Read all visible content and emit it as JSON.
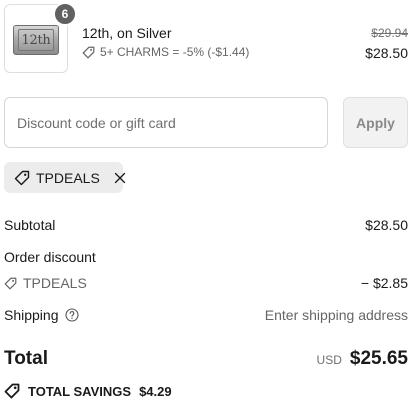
{
  "product": {
    "quantity": "6",
    "thumb_text": "12th",
    "title": "12th, on Silver",
    "discount_note": "5+ CHARMS = -5% (-$1.44)",
    "original_price": "$29.94",
    "price": "$28.50"
  },
  "discount": {
    "placeholder": "Discount code or gift card",
    "apply_label": "Apply",
    "applied_code": "TPDEALS"
  },
  "summary": {
    "subtotal_label": "Subtotal",
    "subtotal_value": "$28.50",
    "order_discount_label": "Order discount",
    "code_label": "TPDEALS",
    "code_value": "− $2.85",
    "shipping_label": "Shipping",
    "shipping_value": "Enter shipping address"
  },
  "total": {
    "label": "Total",
    "currency": "USD",
    "amount": "$25.65"
  },
  "savings": {
    "label": "TOTAL SAVINGS",
    "amount": "$4.29"
  }
}
